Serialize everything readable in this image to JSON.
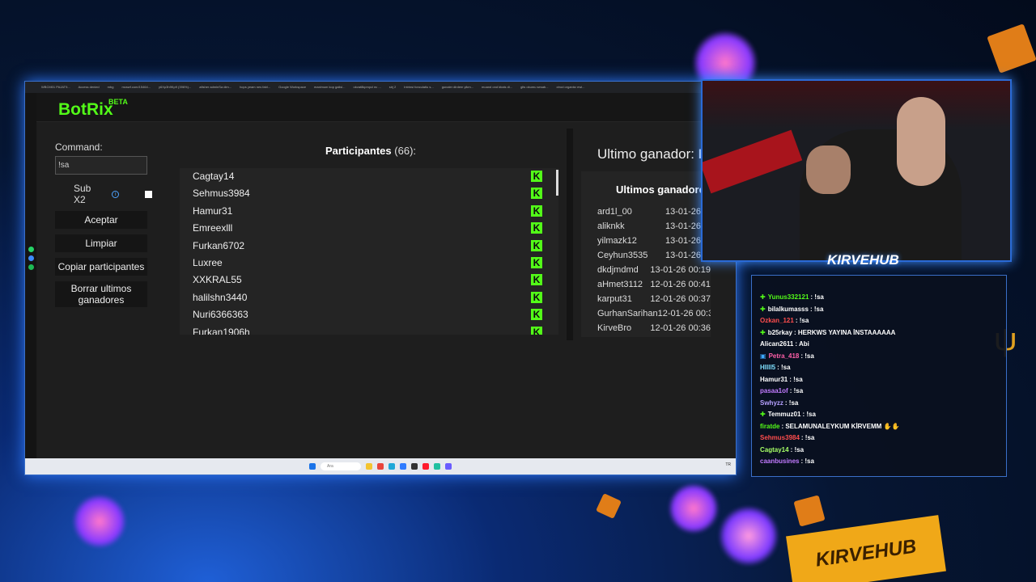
{
  "bookmarks": [
    "WBCM01 PAJAT9...",
    "Access denied",
    "mbg",
    "mcswf.com/15464...",
    "y6Xp3h9Kp9 (396%)...",
    "afisher adminSa dim...",
    "hops yeam nes fabl...",
    "Google Workspace",
    "maximum kop galisl...",
    "okvat8kpmpcl ec ...",
    "sirj 2",
    "Intrinsi fonculatiu s...",
    "gonaler dirdem yikm...",
    "moand ond kbals di...",
    "glts okumu sesab...",
    "ctrod organisr ewi..."
  ],
  "app": {
    "name": "BotRix",
    "badge": "BETA"
  },
  "command": {
    "label": "Command:",
    "value": "!sa"
  },
  "sub": {
    "label": "Sub X2",
    "info": "i"
  },
  "buttons": {
    "accept": "Aceptar",
    "clear": "Limpiar",
    "copy": "Copiar participantes",
    "delete": "Borrar ultimos ganadores"
  },
  "participants": {
    "title": "Participantes",
    "count": "(66):",
    "names": [
      "Cagtay14",
      "Sehmus3984",
      "Hamur31",
      "Emreexlll",
      "Furkan6702",
      "Luxree",
      "XXKRAL55",
      "halilshn3440",
      "Nuri6366363",
      "Furkan1906h"
    ],
    "badge": "K"
  },
  "last_winner": {
    "label": "Ultimo ganador:",
    "value": "N"
  },
  "winners": {
    "title": "Ultimos ganadores",
    "rows": [
      {
        "name": "ard1l_00",
        "date": "13-01-26"
      },
      {
        "name": "aliknkk",
        "date": "13-01-26"
      },
      {
        "name": "yilmazk12",
        "date": "13-01-26"
      },
      {
        "name": "Ceyhun3535",
        "date": "13-01-26"
      },
      {
        "name": "dkdjmdmd",
        "date": "13-01-26 00:19"
      },
      {
        "name": "aHmet3112",
        "date": "12-01-26 00:41"
      },
      {
        "name": "karput31",
        "date": "12-01-26 00:37"
      },
      {
        "name": "GurhanSarihan",
        "date": "12-01-26 00:36"
      },
      {
        "name": "KirveBro",
        "date": "12-01-26 00:36"
      }
    ]
  },
  "taskbar": {
    "search": "Ara",
    "tray": "TR"
  },
  "brand": "KIRVEHUB",
  "chat": [
    {
      "badge": "✚",
      "user": "Yunus332121",
      "color": "#53fc18",
      "msg": ": !sa"
    },
    {
      "badge": "✚",
      "user": "bilalkumasss",
      "color": "#ffffff",
      "msg": ": !sa"
    },
    {
      "badge": "",
      "user": "Ozkan_121",
      "color": "#ff4d4d",
      "msg": ": !sa"
    },
    {
      "badge": "✚",
      "user": "b25rkay",
      "color": "#ffffff",
      "msg": ": HERKWS YAYINA İNSTAAAAAA"
    },
    {
      "badge": "",
      "user": "Alican2611",
      "color": "#ffffff",
      "msg": ": Abi"
    },
    {
      "badge": "▣",
      "user": "Petra_418",
      "color": "#ff5fa8",
      "msg": ": !sa"
    },
    {
      "badge": "",
      "user": "Hllll5",
      "color": "#7fe0ff",
      "msg": ": !sa"
    },
    {
      "badge": "",
      "user": "Hamur31",
      "color": "#ffffff",
      "msg": ": !sa"
    },
    {
      "badge": "",
      "user": "pasaa1of",
      "color": "#c27bff",
      "msg": ": !sa"
    },
    {
      "badge": "",
      "user": "Swhyzz",
      "color": "#b5a0ff",
      "msg": ": !sa"
    },
    {
      "badge": "✚",
      "user": "Temmuz01",
      "color": "#ffffff",
      "msg": ": !sa"
    },
    {
      "badge": "",
      "user": "firatde",
      "color": "#53fc18",
      "msg": ": SELAMUNALEYKUM KİRVEMM ✋✋"
    },
    {
      "badge": "",
      "user": "Sehmus3984",
      "color": "#ff4d4d",
      "msg": ": !sa"
    },
    {
      "badge": "",
      "user": "Cagtay14",
      "color": "#a6ff66",
      "msg": ": !sa"
    },
    {
      "badge": "",
      "user": "caanbusines",
      "color": "#c27bff",
      "msg": ": !sa"
    }
  ],
  "colors": {
    "kick_green": "#53fc18",
    "frame_blue": "#3a6fc8"
  }
}
